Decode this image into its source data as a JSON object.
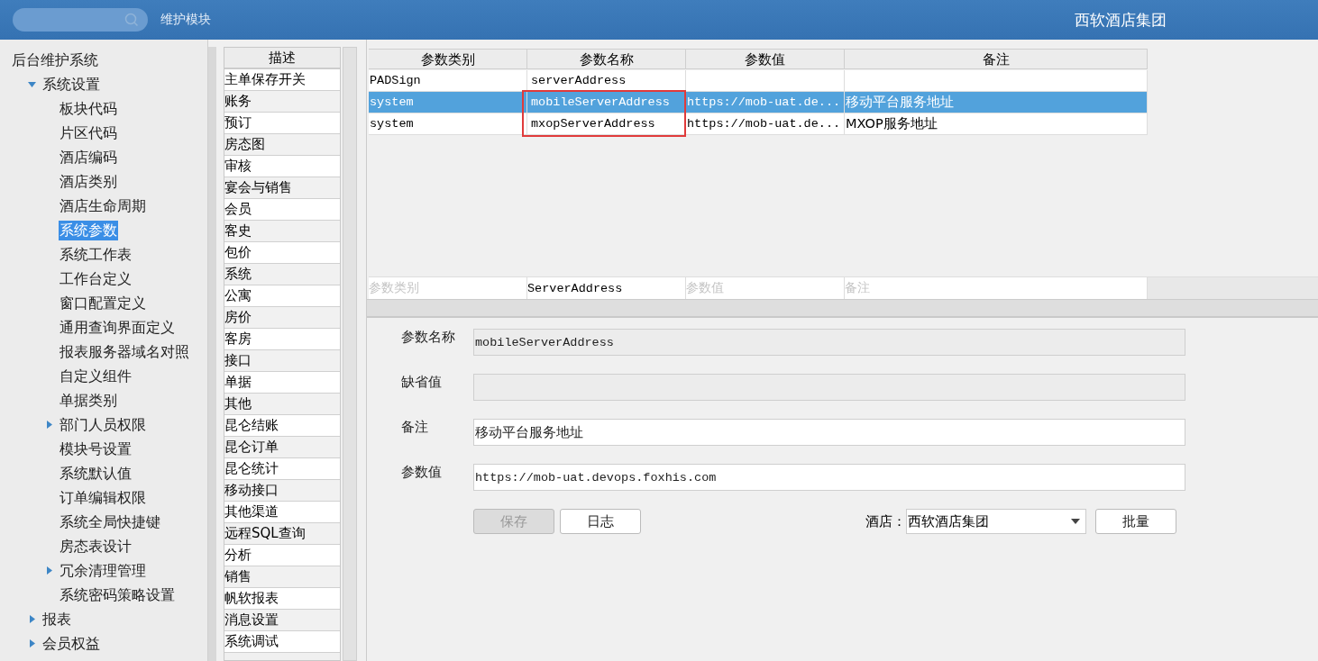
{
  "header": {
    "module_label": "维护模块",
    "org_name": "西软酒店集团"
  },
  "sidebar": {
    "items": [
      {
        "label": "后台维护系统",
        "children": [
          {
            "label": "系统设置",
            "expanded": true,
            "selected": false,
            "children": [
              {
                "label": "板块代码",
                "selected": false
              },
              {
                "label": "片区代码",
                "selected": false
              },
              {
                "label": "酒店编码",
                "selected": false
              },
              {
                "label": "酒店类别",
                "selected": false
              },
              {
                "label": "酒店生命周期",
                "selected": false
              },
              {
                "label": "系统参数",
                "selected": true
              },
              {
                "label": "系统工作表",
                "selected": false
              },
              {
                "label": "工作台定义",
                "selected": false
              },
              {
                "label": "窗口配置定义",
                "selected": false
              },
              {
                "label": "通用查询界面定义",
                "selected": false
              },
              {
                "label": "报表服务器域名对照",
                "selected": false
              },
              {
                "label": "自定义组件",
                "selected": false
              },
              {
                "label": "单据类别",
                "selected": false
              },
              {
                "label": "部门人员权限",
                "selected": false,
                "expanded": false
              },
              {
                "label": "模块号设置",
                "selected": false
              },
              {
                "label": "系统默认值",
                "selected": false
              },
              {
                "label": "订单编辑权限",
                "selected": false
              },
              {
                "label": "系统全局快捷键",
                "selected": false
              },
              {
                "label": "房态表设计",
                "selected": false
              },
              {
                "label": "冗余清理管理",
                "selected": false,
                "expanded": false
              },
              {
                "label": "系统密码策略设置",
                "selected": false
              }
            ]
          },
          {
            "label": "报表",
            "selected": false,
            "expanded": false
          },
          {
            "label": "会员权益",
            "selected": false,
            "expanded": false
          }
        ]
      }
    ]
  },
  "categories": {
    "header": "描述",
    "items": [
      "主单保存开关",
      "账务",
      "预订",
      "房态图",
      "审核",
      "宴会与销售",
      "会员",
      "客史",
      "包价",
      "系统",
      "公寓",
      "房价",
      "客房",
      "接口",
      "单据",
      "其他",
      "昆仑结账",
      "昆仑订单",
      "昆仑统计",
      "移动接口",
      "其他渠道",
      "远程SQL查询",
      "分析",
      "销售",
      "帆软报表",
      "消息设置",
      "系统调试"
    ]
  },
  "table": {
    "columns": [
      "参数类别",
      "参数名称",
      "参数值",
      "备注"
    ],
    "rows": [
      {
        "selected": false,
        "cells": [
          "PADSign",
          "serverAddress",
          "",
          ""
        ]
      },
      {
        "selected": true,
        "cells": [
          "system",
          "mobileServerAddress",
          "https://mob-uat.de...",
          "移动平台服务地址"
        ]
      },
      {
        "selected": false,
        "cells": [
          "system",
          "mxopServerAddress",
          "https://mob-uat.de...",
          "MXOP服务地址"
        ]
      }
    ],
    "filters": [
      {
        "placeholder": "参数类别"
      },
      {
        "value": "ServerAddress"
      },
      {
        "placeholder": "参数值"
      },
      {
        "placeholder": "备注"
      }
    ]
  },
  "form": {
    "fields": [
      {
        "label": "参数名称",
        "value": "mobileServerAddress",
        "disabled": true,
        "mono": true
      },
      {
        "label": "缺省值",
        "disabled": true,
        "mono": true
      },
      {
        "label": "备注",
        "value": "移动平台服务地址",
        "disabled": false,
        "mono": false
      },
      {
        "label": "参数值",
        "value": "https://mob-uat.devops.foxhis.com",
        "disabled": false,
        "mono": true
      }
    ],
    "buttons": [
      {
        "label": "保存",
        "disabled": true
      },
      {
        "label": "日志",
        "disabled": false
      }
    ],
    "hotel_label": "酒店：",
    "hotel_value": "西软酒店集团",
    "batch_button": "批量"
  }
}
